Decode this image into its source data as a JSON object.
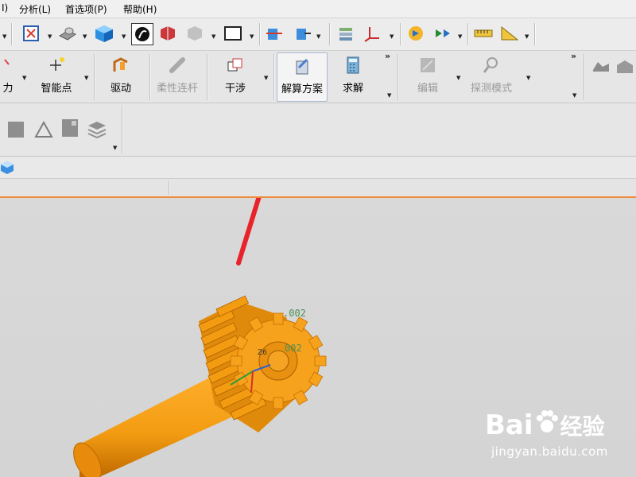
{
  "menubar": {
    "items": [
      "I)",
      "分析(L)",
      "首选项(P)",
      "帮助(H)"
    ]
  },
  "toolbar": {
    "icons": [
      "fit-view-icon",
      "orient-view-icon",
      "shaded-cube-icon",
      "render-style-icon",
      "edge-display-icon",
      "translucent-icon",
      "window-frame-icon",
      "snap-view-icon",
      "section-view-icon",
      "layer-settings-icon",
      "coordinate-system-icon",
      "motion-playback-icon",
      "animation-icon",
      "measure-ruler-icon",
      "angle-measure-icon"
    ]
  },
  "ribbon": {
    "buttons": [
      {
        "label": "力",
        "icon": "force-icon",
        "enabled": true
      },
      {
        "label": "智能点",
        "icon": "smart-point-icon",
        "enabled": true
      },
      {
        "label": "驱动",
        "icon": "driver-icon",
        "enabled": true
      },
      {
        "label": "柔性连杆",
        "icon": "flexible-link-icon",
        "enabled": false
      },
      {
        "label": "干涉",
        "icon": "interference-icon",
        "enabled": true
      },
      {
        "label": "解算方案",
        "icon": "solution-icon",
        "enabled": true,
        "selected": true
      },
      {
        "label": "求解",
        "icon": "solve-icon",
        "enabled": true
      },
      {
        "label": "编辑",
        "icon": "edit-icon",
        "enabled": false
      },
      {
        "label": "探测模式",
        "icon": "probe-mode-icon",
        "enabled": false
      }
    ],
    "more": "»"
  },
  "viewport": {
    "labels": [
      ".002",
      "002"
    ],
    "axis_label": "Z6"
  },
  "watermark": {
    "brand": "Bai",
    "brand_cn": "经验",
    "url": "jingyan.baidu.com"
  },
  "colors": {
    "gear": "#f39c12",
    "arrow": "#e8232a",
    "tab_line": "#f08a3a"
  }
}
